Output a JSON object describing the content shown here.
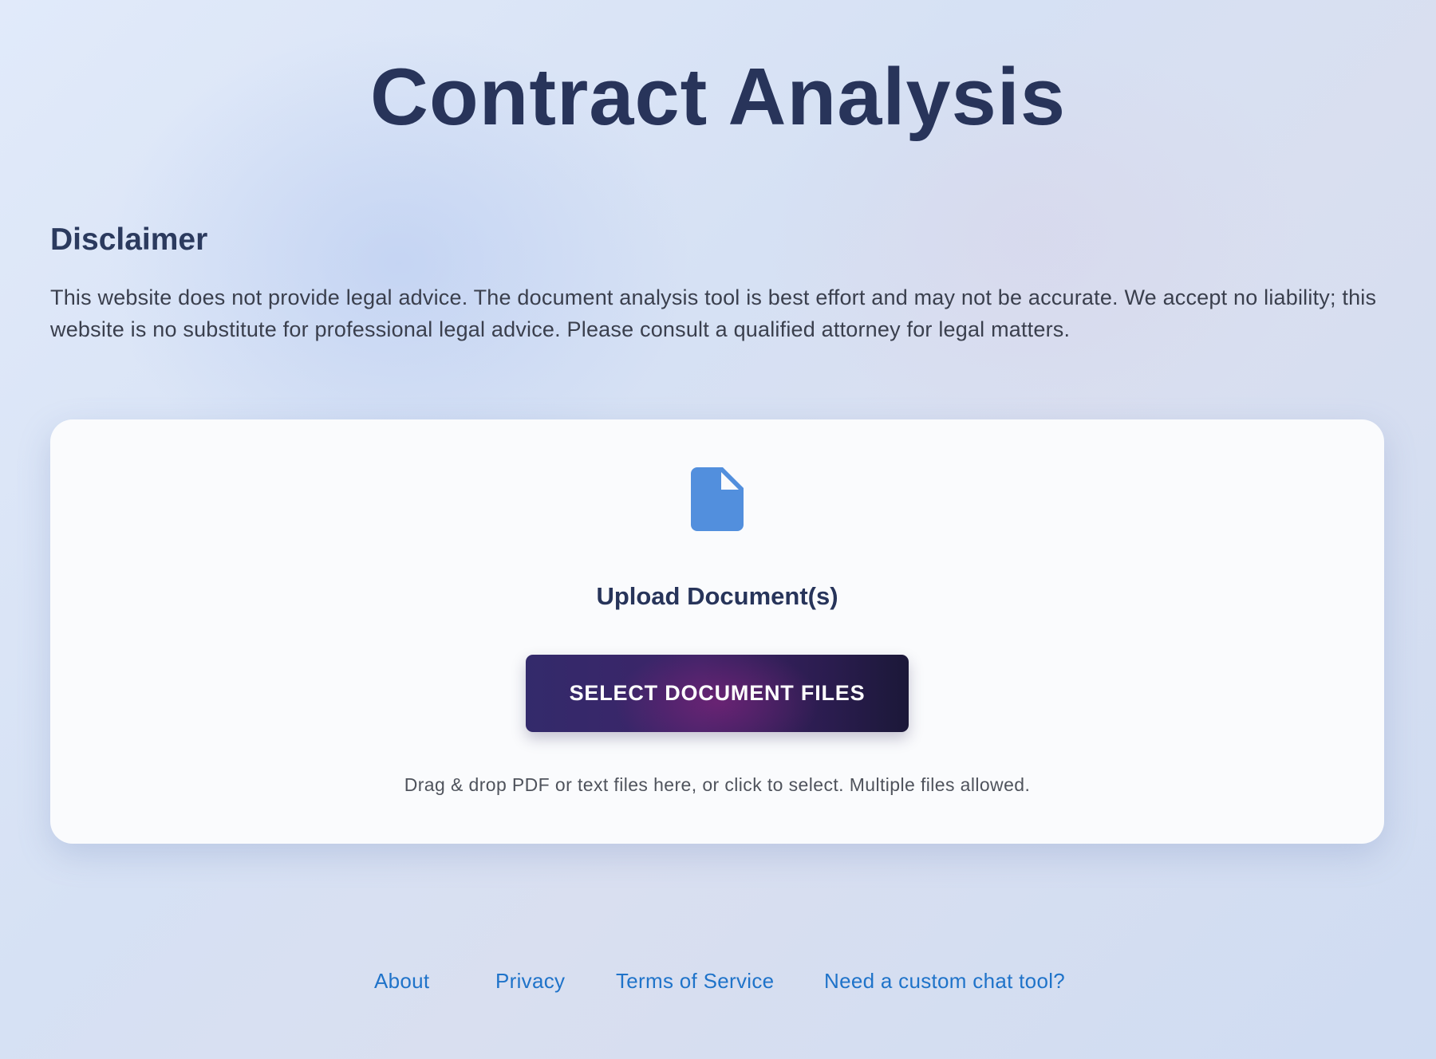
{
  "page": {
    "title": "Contract Analysis"
  },
  "disclaimer": {
    "title": "Disclaimer",
    "text": "This website does not provide legal advice. The document analysis tool is best effort and may not be accurate. We accept no liability; this website is no substitute for professional legal advice. Please consult a qualified attorney for legal matters."
  },
  "upload": {
    "icon": "document-icon",
    "title": "Upload Document(s)",
    "button_label": "SELECT DOCUMENT FILES",
    "hint": "Drag & drop PDF or text files here, or click to select. Multiple files allowed."
  },
  "footer": {
    "links": [
      {
        "label": "About"
      },
      {
        "label": "Privacy"
      },
      {
        "label": "Terms of Service"
      },
      {
        "label": "Need a custom chat tool?"
      }
    ]
  },
  "colors": {
    "title": "#28345a",
    "accent_link": "#1f73c9",
    "icon": "#528fdd",
    "button_start": "#332a6b",
    "button_end": "#1b1838"
  }
}
